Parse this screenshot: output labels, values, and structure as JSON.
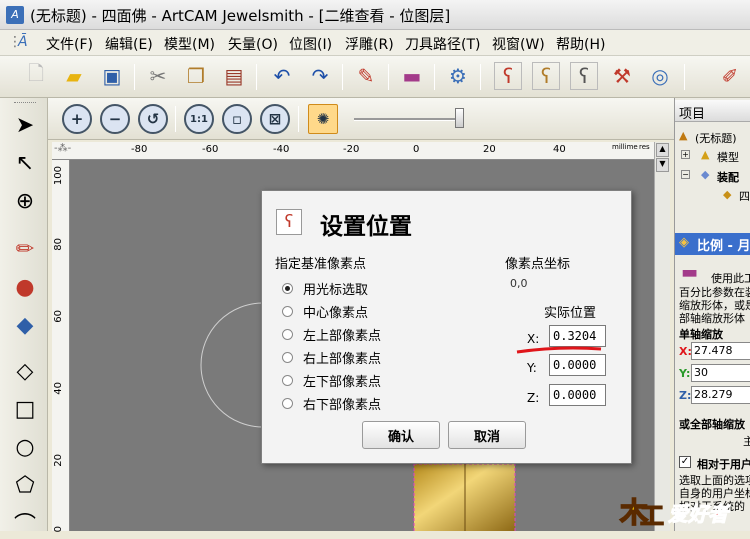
{
  "window": {
    "title": "(无标题) - 四面佛 - ArtCAM Jewelsmith - [二维查看 - 位图层]",
    "app_icon_label": "A"
  },
  "menu": [
    "文件(F)",
    "编辑(E)",
    "模型(M)",
    "矢量(O)",
    "位图(I)",
    "浮雕(R)",
    "刀具路径(T)",
    "视窗(W)",
    "帮助(H)"
  ],
  "view_toolbar": {
    "zoom_in": "+",
    "zoom_out": "−",
    "fit": "1:1",
    "slider_level": 1.0
  },
  "ruler": {
    "units": "millime",
    "units2": "res",
    "x_ticks": [
      "-80",
      "-60",
      "-40",
      "-20",
      "0",
      "20",
      "40"
    ],
    "y_ticks": [
      "100",
      "80",
      "60",
      "40",
      "20",
      "0"
    ]
  },
  "dialog": {
    "title": "设置位置",
    "ref_label": "指定基准像素点",
    "options": [
      "用光标选取",
      "中心像素点",
      "左上部像素点",
      "右上部像素点",
      "左下部像素点",
      "右下部像素点"
    ],
    "selected_index": 0,
    "pixel_coord_label": "像素点坐标",
    "pixel_coord_value": "0,0",
    "actual_pos_label": "实际位置",
    "x_label": "X:",
    "x_value": "0.3204",
    "y_label": "Y:",
    "y_value": "0.0000",
    "z_label": "Z:",
    "z_value": "0.0000",
    "ok": "确认",
    "cancel": "取消"
  },
  "right_panel": {
    "project_title": "项目",
    "tree_root": "(无标题)",
    "tree_model": "模型",
    "tree_assembly": "装配",
    "tree_child": "四",
    "scale_title": "比例 - 月",
    "desc_lines": [
      "使用此工",
      "百分比参数在装",
      "缩放形体，或是",
      "部轴缩放形体"
    ],
    "single_axis": "单轴缩放",
    "x_label": "X:",
    "x_value": "27.478",
    "y_label": "Y:",
    "y_value": "30",
    "z_label": "Z:",
    "z_value": "28.279",
    "all_axis": "或全部轴缩放",
    "all_axis_char": "主",
    "relative_label": "相对于用户",
    "bottom_lines": [
      "选取上面的选项",
      "自身的用户坐标",
      "相对于系统的"
    ]
  },
  "watermark": {
    "text": "爱好者"
  },
  "colors": {
    "accent_red": "#e0151a",
    "canvas": "#7a7a7a",
    "panel_blue": "#3a6fcc"
  }
}
